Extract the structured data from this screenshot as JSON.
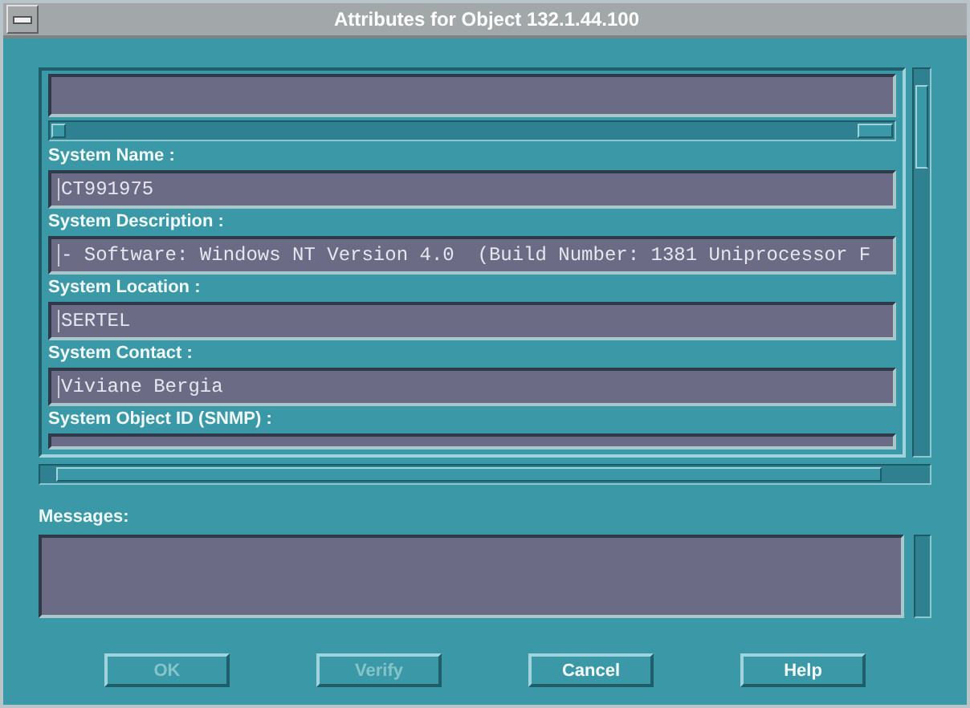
{
  "window": {
    "title": "Attributes for Object 132.1.44.100"
  },
  "fields": [
    {
      "label": "System Name :",
      "value": "CT991975"
    },
    {
      "label": "System Description :",
      "value": "- Software: Windows NT Version 4.0  (Build Number: 1381 Uniprocessor F"
    },
    {
      "label": "System Location :",
      "value": "SERTEL"
    },
    {
      "label": "System Contact :",
      "value": "Viviane Bergia"
    },
    {
      "label": "System Object ID (SNMP) :"
    }
  ],
  "messages": {
    "label": "Messages:"
  },
  "buttons": [
    {
      "label": "OK",
      "disabled": true
    },
    {
      "label": "Verify",
      "disabled": true
    },
    {
      "label": "Cancel",
      "disabled": false
    },
    {
      "label": "Help",
      "disabled": false
    }
  ]
}
